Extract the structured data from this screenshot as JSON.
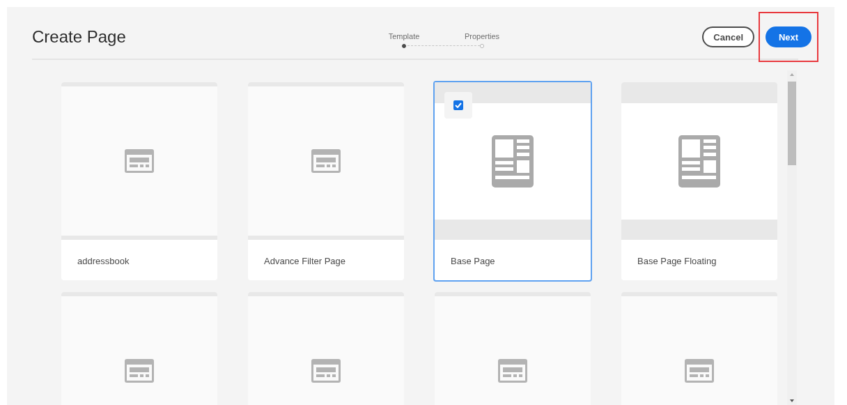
{
  "title": "Create Page",
  "steps": [
    {
      "label": "Template",
      "selected": true
    },
    {
      "label": "Properties",
      "selected": false
    }
  ],
  "buttons": [
    {
      "label": "Cancel",
      "kind": "secondary",
      "highlighted": false
    },
    {
      "label": "Next",
      "kind": "primary",
      "highlighted": true
    }
  ],
  "cards": [
    {
      "label": "addressbook",
      "kind": "basic",
      "selected": false
    },
    {
      "label": "Advance Filter Page",
      "kind": "basic",
      "selected": false
    },
    {
      "label": "Base Page",
      "kind": "layout",
      "selected": true
    },
    {
      "label": "Base Page Floating",
      "kind": "layout",
      "selected": false
    },
    {
      "kind": "basic",
      "selected": false
    },
    {
      "kind": "basic",
      "selected": false
    },
    {
      "kind": "basic",
      "selected": false
    },
    {
      "kind": "basic",
      "selected": false
    }
  ]
}
